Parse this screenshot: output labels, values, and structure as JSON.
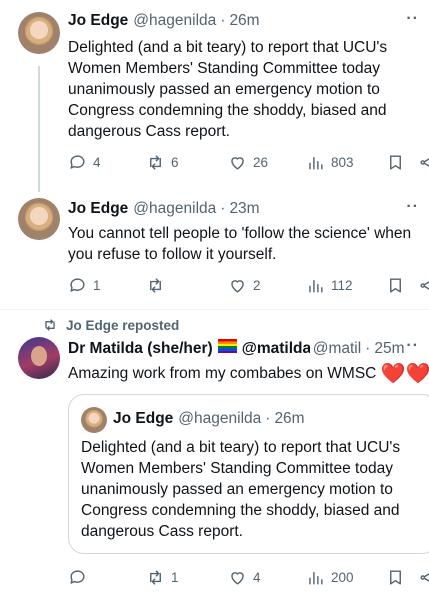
{
  "tweets": [
    {
      "author": "Jo Edge",
      "handle": "@hagenilda",
      "separator": "·",
      "time": "26m",
      "lines": [
        "Delighted (and a bit teary) to report that UCU's",
        "Women Members' Standing Committee today",
        "unanimously passed an emergency motion to",
        "Congress condemning the shoddy, biased and",
        "dangerous Cass report."
      ],
      "replies": "4",
      "reposts": "6",
      "likes": "26",
      "views": "803"
    },
    {
      "author": "Jo Edge",
      "handle": "@hagenilda",
      "separator": "·",
      "time": "23m",
      "lines": [
        "You cannot tell people to 'follow the science' when",
        "you refuse to follow it yourself."
      ],
      "replies": "1",
      "reposts": "",
      "likes": "2",
      "views": "112"
    }
  ],
  "repost_label": "Jo Edge reposted",
  "reposted": {
    "author": "Dr Matilda (she/her)",
    "handle": "@matilda",
    "handle2": "@matil",
    "separator": "·",
    "time": "25m",
    "text": "Amazing work from my combabes on WMSC",
    "hearts": "❤️❤️",
    "replies": "",
    "reposts": "1",
    "likes": "4",
    "views": "200"
  },
  "quoted": {
    "author": "Jo Edge",
    "handle": "@hagenilda",
    "separator": "·",
    "time": "26m",
    "lines": [
      "Delighted (and a bit teary) to report that UCU's",
      "Women Members' Standing Committee today",
      "unanimously passed an emergency motion to",
      "Congress condemning the shoddy, biased and",
      "dangerous Cass report."
    ]
  },
  "more_glyph": "··",
  "icons": [
    "reply-icon",
    "repost-icon",
    "like-icon",
    "views-icon",
    "bookmark-icon",
    "share-icon",
    "more-icon",
    "pride-flag-icon"
  ],
  "colors": {
    "text": "#0f1419",
    "secondary": "#536471",
    "border": "#cfd9de",
    "heart": "#e0245e"
  }
}
